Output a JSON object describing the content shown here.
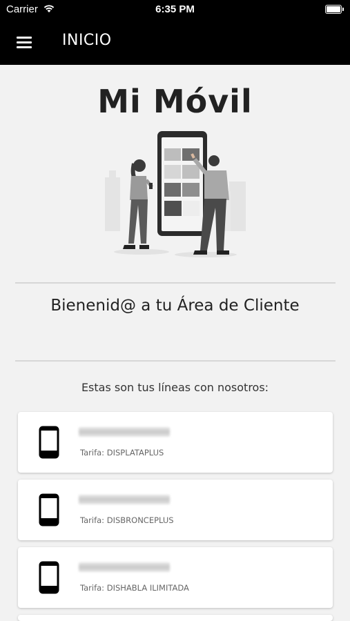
{
  "status_bar": {
    "carrier": "Carrier",
    "time": "6:35 PM"
  },
  "app_bar": {
    "title": "INICIO",
    "menu_icon": "hamburger-menu-icon"
  },
  "hero": {
    "title": "Mi Móvil"
  },
  "welcome": {
    "text": "Bienenid@ a tu Área de Cliente"
  },
  "lines": {
    "caption": "Estas son tus líneas con nosotros:",
    "items": [
      {
        "tarifa": "Tarifa: DISPLATAPLUS",
        "icon": "phone-icon"
      },
      {
        "tarifa": "Tarifa: DISBRONCEPLUS",
        "icon": "phone-icon"
      },
      {
        "tarifa": "Tarifa: DISHABLA ILIMITADA",
        "icon": "phone-icon"
      }
    ]
  },
  "colors": {
    "app_bar": "#000000",
    "background": "#f2f2f2",
    "card": "#ffffff"
  }
}
